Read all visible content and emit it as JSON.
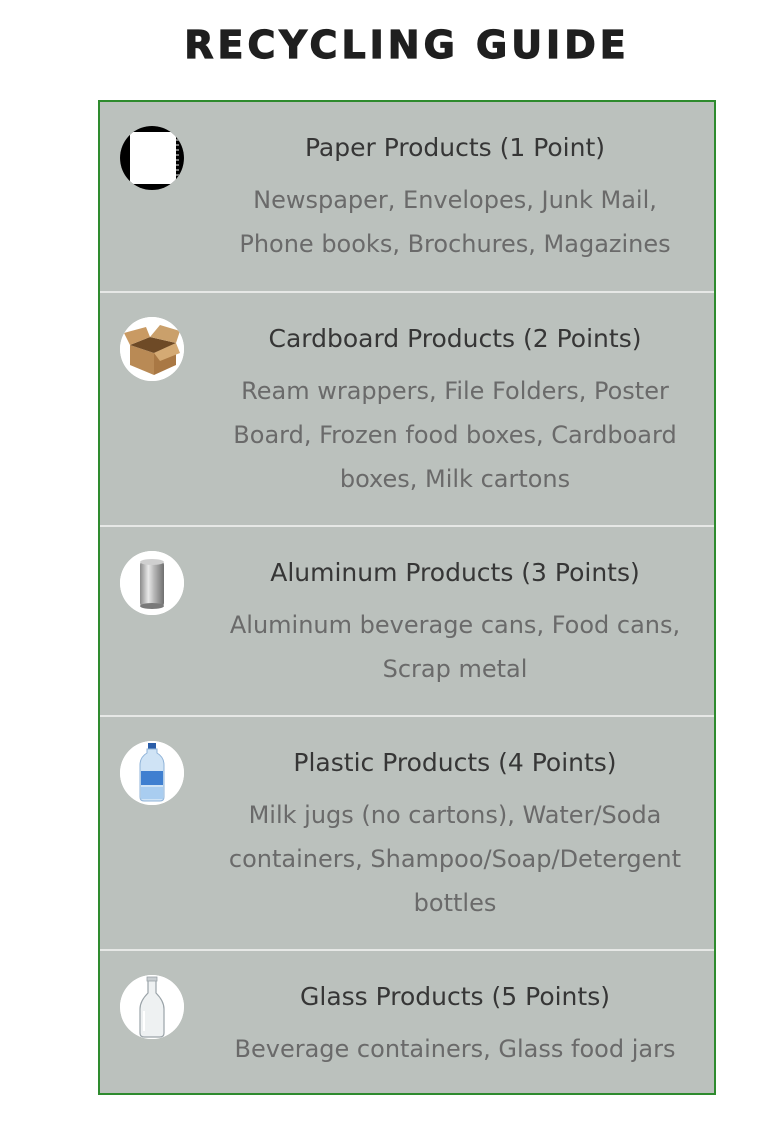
{
  "page": {
    "title": "RECYCLING GUIDE"
  },
  "colors": {
    "border": "#2e8b2e",
    "panel_bg": "#bbc1bd",
    "divider": "#e6e8e6",
    "title_text": "#1f1f1f",
    "item_title_text": "#363636",
    "item_desc_text": "#6a6a6a"
  },
  "items": [
    {
      "icon": "paper-notebook-icon",
      "title": "Paper Products (1 Point)",
      "description": "Newspaper, Envelopes, Junk Mail, Phone books, Brochures, Magazines"
    },
    {
      "icon": "cardboard-box-icon",
      "title": "Cardboard Products (2 Points)",
      "description": "Ream wrappers, File Folders, Poster Board, Frozen food boxes, Cardboard boxes, Milk cartons"
    },
    {
      "icon": "aluminum-can-icon",
      "title": "Aluminum Products (3 Points)",
      "description": "Aluminum beverage cans, Food cans, Scrap metal"
    },
    {
      "icon": "plastic-bottle-icon",
      "title": "Plastic Products (4 Points)",
      "description": "Milk jugs (no cartons), Water/Soda containers, Shampoo/Soap/Detergent bottles"
    },
    {
      "icon": "glass-bottle-icon",
      "title": "Glass Products (5 Points)",
      "description": "Beverage containers, Glass food jars"
    }
  ]
}
